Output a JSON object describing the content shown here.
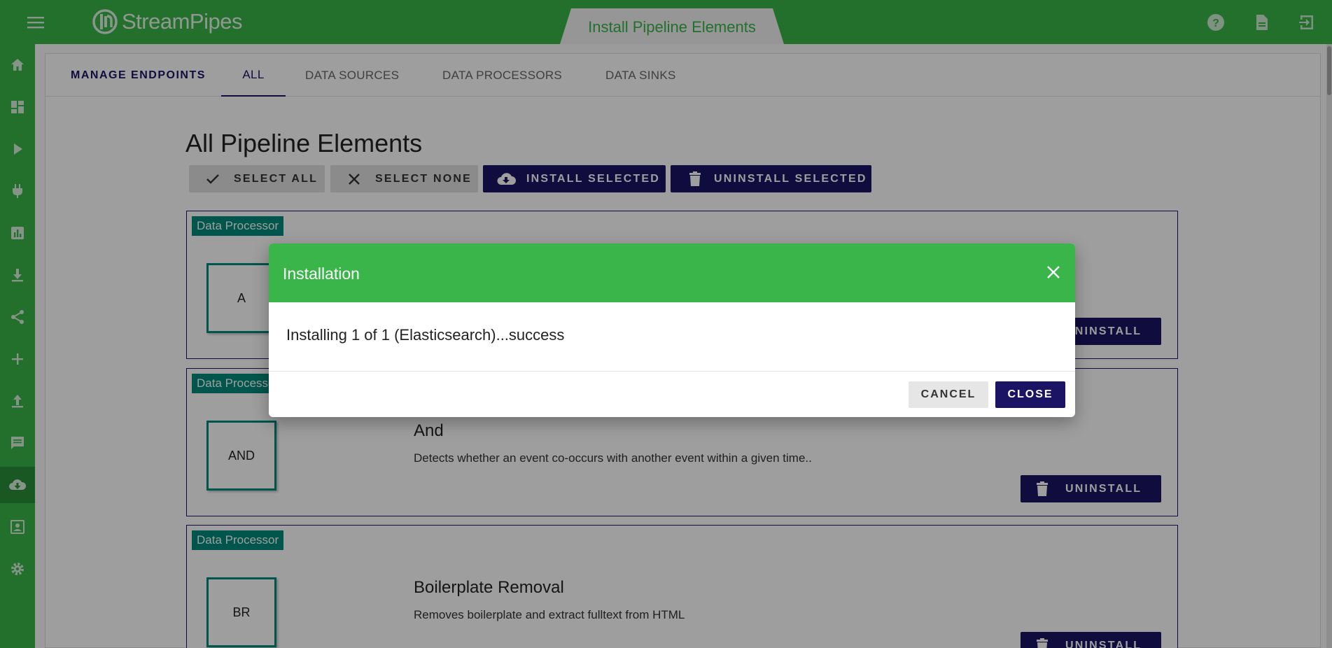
{
  "app": {
    "logo_text": "StreamPipes",
    "page_tab": "Install Pipeline Elements"
  },
  "topbar": {
    "icons": [
      "help-icon",
      "docs-icon",
      "logout-icon"
    ]
  },
  "sidebar": {
    "items": [
      "home-icon",
      "dashboard-icon",
      "play-icon",
      "plug-icon",
      "chart-icon",
      "download-icon",
      "share-icon",
      "plus-icon",
      "upload-icon",
      "chat-icon",
      "cloud-download-icon",
      "contact-icon",
      "settings-icon"
    ],
    "active": "cloud-download-icon"
  },
  "tabs": {
    "manage": "MANAGE ENDPOINTS",
    "all": "ALL",
    "sources": "DATA SOURCES",
    "processors": "DATA PROCESSORS",
    "sinks": "DATA SINKS"
  },
  "main": {
    "heading": "All Pipeline Elements",
    "buttons": {
      "select_all": "SELECT ALL",
      "select_none": "SELECT NONE",
      "install_selected": "INSTALL SELECTED",
      "uninstall_selected": "UNINSTALL SELECTED"
    },
    "elements": [
      {
        "badge": "Data Processor",
        "icon": "A",
        "title": "",
        "description": "",
        "action": "UNINSTALL"
      },
      {
        "badge": "Data Processor",
        "icon": "AND",
        "title": "And",
        "description": "Detects whether an event co-occurs with another event within a given time..",
        "action": "UNINSTALL"
      },
      {
        "badge": "Data Processor",
        "icon": "BR",
        "title": "Boilerplate Removal",
        "description": "Removes boilerplate and extract fulltext from HTML",
        "action": "UNINSTALL"
      }
    ]
  },
  "dialog": {
    "title": "Installation",
    "message": "Installing 1 of 1 (Elasticsearch)...success",
    "cancel": "CANCEL",
    "close": "CLOSE"
  },
  "colors": {
    "brand_green": "#39b54a",
    "navy": "#1b1464",
    "teal": "#00897b"
  }
}
